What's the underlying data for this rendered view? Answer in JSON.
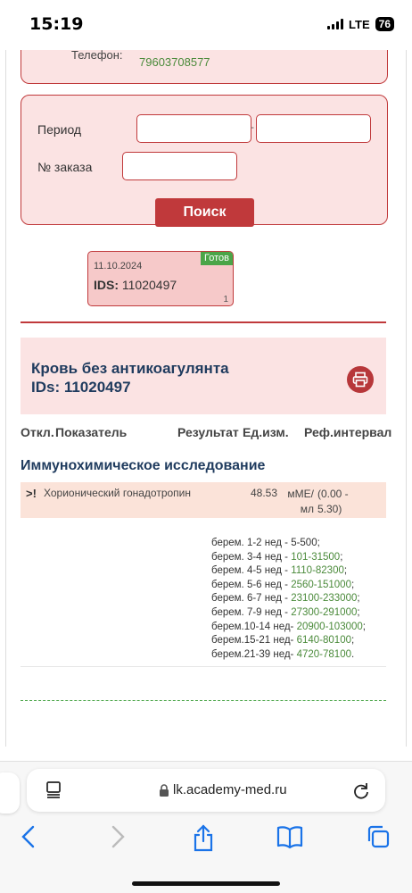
{
  "status_bar": {
    "time": "15:19",
    "network": "LTE",
    "battery": "76"
  },
  "contact": {
    "phone_label": "Телефон:",
    "phone_values": [
      "79603708577",
      "79603708577"
    ]
  },
  "search_form": {
    "period_label": "Период",
    "period_separator": "-",
    "order_label": "№ заказа",
    "period_from": "",
    "period_to": "",
    "order_number": "",
    "search_button": "Поиск"
  },
  "order_card": {
    "date": "11.10.2024",
    "ids_label": "IDS:",
    "ids_value": "11020497",
    "status": "Готов",
    "count": "1"
  },
  "result": {
    "title": "Кровь без антикоагулянта",
    "ids_line": "IDs: 11020497",
    "columns": [
      "Откл.",
      "Показатель",
      "Результат",
      "Ед.изм.",
      "Реф.интервал"
    ],
    "section": "Иммунохимическое исследование",
    "row": {
      "flag": ">!",
      "name": "Хорионический гонадотропин",
      "value": "48.53",
      "unit": "мМЕ/ мл",
      "ref": "(0.00 - 5.30)"
    },
    "ref_notes": [
      {
        "label": "берем. 1-2 нед - ",
        "range": "5-500",
        "suffix": ";",
        "range_green": false
      },
      {
        "label": "берем. 3-4 нед - ",
        "range": "101-31500",
        "suffix": ";",
        "range_green": true
      },
      {
        "label": "берем. 4-5 нед - ",
        "range": "1110-82300",
        "suffix": ";",
        "range_green": true
      },
      {
        "label": "берем. 5-6 нед - ",
        "range": "2560-151000",
        "suffix": ";",
        "range_green": true
      },
      {
        "label": "берем. 6-7 нед - ",
        "range": "23100-233000",
        "suffix": ";",
        "range_green": true
      },
      {
        "label": "берем. 7-9 нед - ",
        "range": "27300-291000",
        "suffix": ";",
        "range_green": true
      },
      {
        "label": "берем.10-14 нед- ",
        "range": "20900-103000",
        "suffix": ";",
        "range_green": true
      },
      {
        "label": "берем.15-21 нед- ",
        "range": "6140-80100",
        "suffix": ";",
        "range_green": true
      },
      {
        "label": "берем.21-39 нед- ",
        "range": "4720-78100",
        "suffix": ".",
        "range_green": true
      }
    ]
  },
  "browser": {
    "url": "lk.academy-med.ru"
  }
}
